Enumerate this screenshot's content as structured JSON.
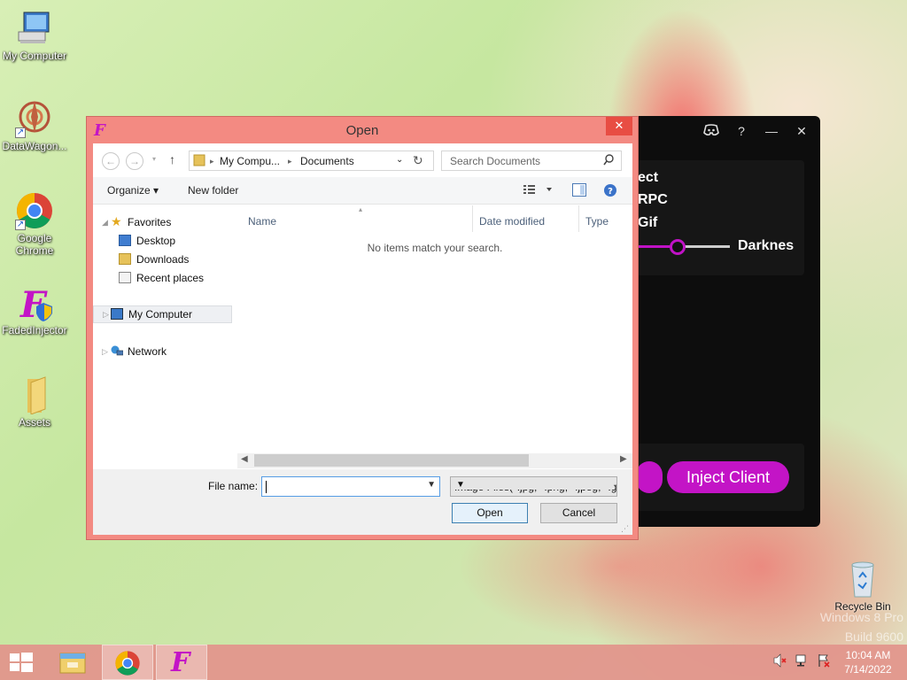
{
  "desktop": {
    "icons": [
      {
        "label": "My Computer"
      },
      {
        "label": "DataWagon..."
      },
      {
        "label": "Google Chrome"
      },
      {
        "label": "FadedInjector"
      },
      {
        "label": "Assets"
      },
      {
        "label": "Recycle Bin"
      }
    ],
    "watermark_line1": "Windows 8 Pro",
    "watermark_line2": "Build 9600"
  },
  "injector": {
    "options": [
      "ect",
      "RPC",
      "Gif"
    ],
    "slider_label": "Darknes",
    "slider_value_percent": 46,
    "inject_button": "Inject Client",
    "titlebar_help": "?",
    "titlebar_minimize": "—",
    "titlebar_close": "✕"
  },
  "dialog": {
    "title": "Open",
    "close": "✕",
    "breadcrumb": [
      "My Compu...",
      "Documents"
    ],
    "search_placeholder": "Search Documents",
    "organize": "Organize ▾",
    "new_folder": "New folder",
    "nav": {
      "favorites": "Favorites",
      "desktop": "Desktop",
      "downloads": "Downloads",
      "recent": "Recent places",
      "my_computer": "My Computer",
      "network": "Network"
    },
    "columns": {
      "name": "Name",
      "date": "Date modified",
      "type": "Type"
    },
    "empty_message": "No items match your search.",
    "file_name_label": "File name:",
    "file_name_value": "",
    "file_type": "Image Files(*.jpg; *.png; *.jpeg; *.gif)",
    "open_button": "Open",
    "cancel_button": "Cancel"
  },
  "taskbar": {
    "time": "10:04 AM",
    "date": "7/14/2022"
  },
  "colors": {
    "accent": "#c314c6",
    "dialog_frame": "#f38a82",
    "close_red": "#e84d43"
  }
}
